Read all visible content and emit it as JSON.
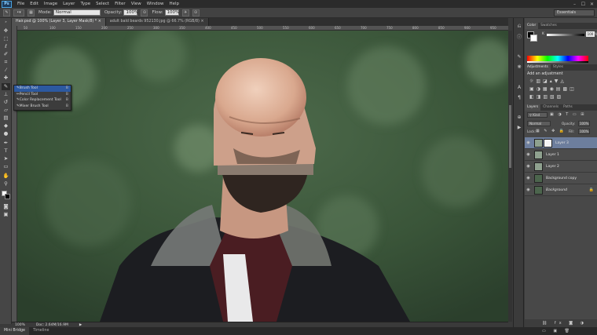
{
  "app": {
    "logo": "Ps",
    "menu": [
      "File",
      "Edit",
      "Image",
      "Layer",
      "Type",
      "Select",
      "Filter",
      "View",
      "Window",
      "Help"
    ],
    "window_controls": [
      "–",
      "☐",
      "✕"
    ]
  },
  "options_bar": {
    "mode_label": "Mode:",
    "mode_value": "Normal",
    "opacity_label": "Opacity:",
    "opacity_value": "100%",
    "flow_label": "Flow:",
    "flow_value": "100%",
    "workspace": "Essentials"
  },
  "tabs": [
    {
      "label": "Hair.psd @ 100% (Layer 3, Layer Mask/8) *",
      "active": true
    },
    {
      "label": "adult bald beards 952130.jpg @ 66.7% (RGB/8)",
      "active": false
    }
  ],
  "ruler_h": [
    "50",
    "100",
    "150",
    "200",
    "250",
    "300",
    "350",
    "400",
    "450",
    "500",
    "550",
    "600",
    "650",
    "700",
    "750",
    "800",
    "850",
    "900",
    "950"
  ],
  "flyout": [
    {
      "label": "Brush Tool",
      "key": "B",
      "selected": true
    },
    {
      "label": "Pencil Tool",
      "key": "B",
      "selected": false
    },
    {
      "label": "Color Replacement Tool",
      "key": "B",
      "selected": false
    },
    {
      "label": "Mixer Brush Tool",
      "key": "B",
      "selected": false
    }
  ],
  "status": {
    "zoom": "100%",
    "doc": "Doc: 2.64M/16.9M"
  },
  "bottom_tabs": [
    {
      "label": "Mini Bridge",
      "active": true
    },
    {
      "label": "Timeline",
      "active": false
    }
  ],
  "color_panel": {
    "tabs": [
      "Color",
      "Swatches"
    ],
    "k_label": "K",
    "k_value": "100",
    "pct": "%"
  },
  "adjustments_panel": {
    "tabs": [
      "Adjustments",
      "Styles"
    ],
    "title": "Add an adjustment"
  },
  "layers_panel": {
    "tabs": [
      "Layers",
      "Channels",
      "Paths"
    ],
    "kind": "Kind",
    "blend": "Normal",
    "opacity_label": "Opacity:",
    "opacity_value": "100%",
    "lock_label": "Lock:",
    "fill_label": "Fill:",
    "fill_value": "100%",
    "layers": [
      {
        "name": "Layer 3",
        "selected": true,
        "italic": false,
        "mask": true,
        "lock": ""
      },
      {
        "name": "Layer 1",
        "selected": false,
        "italic": false,
        "mask": false,
        "lock": ""
      },
      {
        "name": "Layer 2",
        "selected": false,
        "italic": false,
        "mask": false,
        "lock": ""
      },
      {
        "name": "Background copy",
        "selected": false,
        "italic": false,
        "mask": false,
        "lock": ""
      },
      {
        "name": "Background",
        "selected": false,
        "italic": true,
        "mask": false,
        "lock": "🔒"
      }
    ]
  },
  "colors": {
    "accent": "#2c59a0",
    "selected_layer": "#6d7e9d"
  }
}
